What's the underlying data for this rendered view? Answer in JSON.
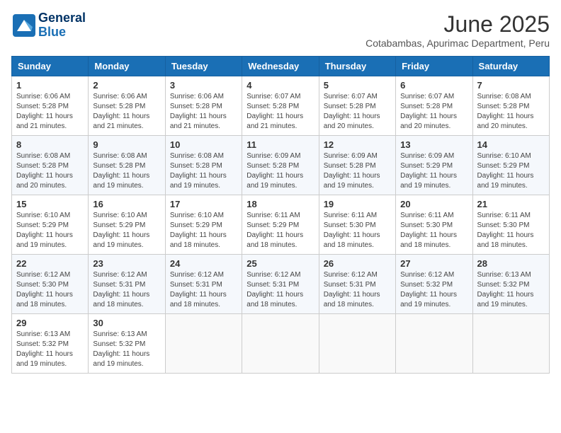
{
  "header": {
    "logo_line1": "General",
    "logo_line2": "Blue",
    "month_title": "June 2025",
    "subtitle": "Cotabambas, Apurimac Department, Peru"
  },
  "days_of_week": [
    "Sunday",
    "Monday",
    "Tuesday",
    "Wednesday",
    "Thursday",
    "Friday",
    "Saturday"
  ],
  "weeks": [
    [
      {
        "day": "1",
        "detail": "Sunrise: 6:06 AM\nSunset: 5:28 PM\nDaylight: 11 hours\nand 21 minutes."
      },
      {
        "day": "2",
        "detail": "Sunrise: 6:06 AM\nSunset: 5:28 PM\nDaylight: 11 hours\nand 21 minutes."
      },
      {
        "day": "3",
        "detail": "Sunrise: 6:06 AM\nSunset: 5:28 PM\nDaylight: 11 hours\nand 21 minutes."
      },
      {
        "day": "4",
        "detail": "Sunrise: 6:07 AM\nSunset: 5:28 PM\nDaylight: 11 hours\nand 21 minutes."
      },
      {
        "day": "5",
        "detail": "Sunrise: 6:07 AM\nSunset: 5:28 PM\nDaylight: 11 hours\nand 20 minutes."
      },
      {
        "day": "6",
        "detail": "Sunrise: 6:07 AM\nSunset: 5:28 PM\nDaylight: 11 hours\nand 20 minutes."
      },
      {
        "day": "7",
        "detail": "Sunrise: 6:08 AM\nSunset: 5:28 PM\nDaylight: 11 hours\nand 20 minutes."
      }
    ],
    [
      {
        "day": "8",
        "detail": "Sunrise: 6:08 AM\nSunset: 5:28 PM\nDaylight: 11 hours\nand 20 minutes."
      },
      {
        "day": "9",
        "detail": "Sunrise: 6:08 AM\nSunset: 5:28 PM\nDaylight: 11 hours\nand 19 minutes."
      },
      {
        "day": "10",
        "detail": "Sunrise: 6:08 AM\nSunset: 5:28 PM\nDaylight: 11 hours\nand 19 minutes."
      },
      {
        "day": "11",
        "detail": "Sunrise: 6:09 AM\nSunset: 5:28 PM\nDaylight: 11 hours\nand 19 minutes."
      },
      {
        "day": "12",
        "detail": "Sunrise: 6:09 AM\nSunset: 5:28 PM\nDaylight: 11 hours\nand 19 minutes."
      },
      {
        "day": "13",
        "detail": "Sunrise: 6:09 AM\nSunset: 5:29 PM\nDaylight: 11 hours\nand 19 minutes."
      },
      {
        "day": "14",
        "detail": "Sunrise: 6:10 AM\nSunset: 5:29 PM\nDaylight: 11 hours\nand 19 minutes."
      }
    ],
    [
      {
        "day": "15",
        "detail": "Sunrise: 6:10 AM\nSunset: 5:29 PM\nDaylight: 11 hours\nand 19 minutes."
      },
      {
        "day": "16",
        "detail": "Sunrise: 6:10 AM\nSunset: 5:29 PM\nDaylight: 11 hours\nand 19 minutes."
      },
      {
        "day": "17",
        "detail": "Sunrise: 6:10 AM\nSunset: 5:29 PM\nDaylight: 11 hours\nand 18 minutes."
      },
      {
        "day": "18",
        "detail": "Sunrise: 6:11 AM\nSunset: 5:29 PM\nDaylight: 11 hours\nand 18 minutes."
      },
      {
        "day": "19",
        "detail": "Sunrise: 6:11 AM\nSunset: 5:30 PM\nDaylight: 11 hours\nand 18 minutes."
      },
      {
        "day": "20",
        "detail": "Sunrise: 6:11 AM\nSunset: 5:30 PM\nDaylight: 11 hours\nand 18 minutes."
      },
      {
        "day": "21",
        "detail": "Sunrise: 6:11 AM\nSunset: 5:30 PM\nDaylight: 11 hours\nand 18 minutes."
      }
    ],
    [
      {
        "day": "22",
        "detail": "Sunrise: 6:12 AM\nSunset: 5:30 PM\nDaylight: 11 hours\nand 18 minutes."
      },
      {
        "day": "23",
        "detail": "Sunrise: 6:12 AM\nSunset: 5:31 PM\nDaylight: 11 hours\nand 18 minutes."
      },
      {
        "day": "24",
        "detail": "Sunrise: 6:12 AM\nSunset: 5:31 PM\nDaylight: 11 hours\nand 18 minutes."
      },
      {
        "day": "25",
        "detail": "Sunrise: 6:12 AM\nSunset: 5:31 PM\nDaylight: 11 hours\nand 18 minutes."
      },
      {
        "day": "26",
        "detail": "Sunrise: 6:12 AM\nSunset: 5:31 PM\nDaylight: 11 hours\nand 18 minutes."
      },
      {
        "day": "27",
        "detail": "Sunrise: 6:12 AM\nSunset: 5:32 PM\nDaylight: 11 hours\nand 19 minutes."
      },
      {
        "day": "28",
        "detail": "Sunrise: 6:13 AM\nSunset: 5:32 PM\nDaylight: 11 hours\nand 19 minutes."
      }
    ],
    [
      {
        "day": "29",
        "detail": "Sunrise: 6:13 AM\nSunset: 5:32 PM\nDaylight: 11 hours\nand 19 minutes."
      },
      {
        "day": "30",
        "detail": "Sunrise: 6:13 AM\nSunset: 5:32 PM\nDaylight: 11 hours\nand 19 minutes."
      },
      null,
      null,
      null,
      null,
      null
    ]
  ]
}
